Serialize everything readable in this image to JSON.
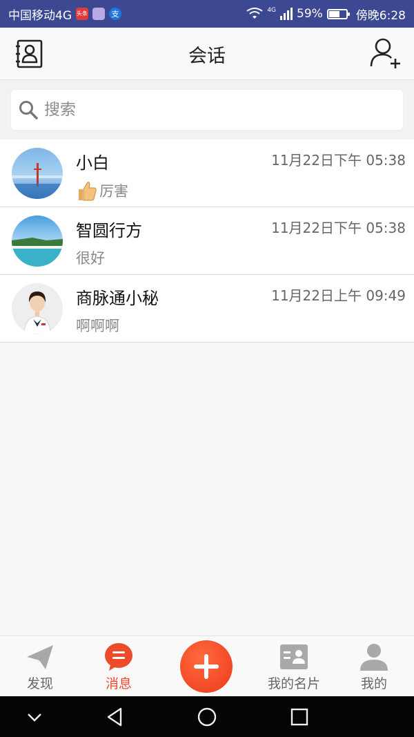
{
  "status_bar": {
    "carrier": "中国移动4G",
    "network": "4G",
    "battery": "59%",
    "time": "傍晚6:28",
    "mini_icons": [
      "头条",
      "app",
      "支"
    ]
  },
  "header": {
    "title": "会话",
    "left_icon": "contacts-book-icon",
    "right_icon": "add-friend-icon"
  },
  "search": {
    "placeholder": "搜索"
  },
  "conversations": [
    {
      "name": "小白",
      "time": "11月22日下午 05:38",
      "preview": "厉害",
      "has_thumb_emoji": true
    },
    {
      "name": "智圆行方",
      "time": "11月22日下午 05:38",
      "preview": "很好",
      "has_thumb_emoji": false
    },
    {
      "name": "商脉通小秘",
      "time": "11月22日上午 09:49",
      "preview": "啊啊啊",
      "has_thumb_emoji": false
    }
  ],
  "bottom_nav": {
    "items": [
      {
        "label": "发现",
        "icon": "paper-plane-icon"
      },
      {
        "label": "消息",
        "icon": "message-bubble-icon",
        "active": true
      },
      {
        "label": "",
        "icon": "plus-icon"
      },
      {
        "label": "我的名片",
        "icon": "business-card-icon"
      },
      {
        "label": "我的",
        "icon": "person-icon"
      }
    ]
  },
  "colors": {
    "status_bar": "#3c4891",
    "accent": "#ee4b2b",
    "inactive_icon": "#a9a9a9"
  }
}
